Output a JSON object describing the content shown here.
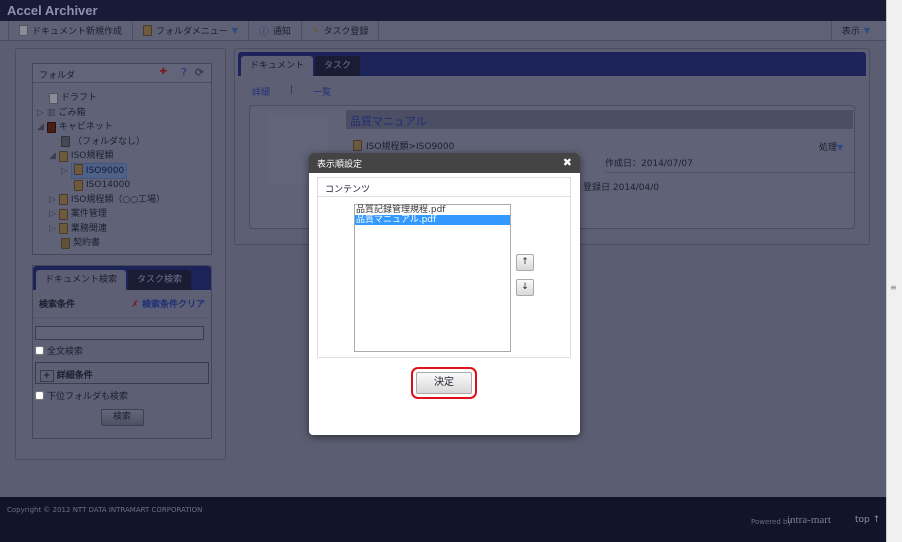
{
  "app": {
    "title": "Accel Archiver"
  },
  "toolbar": {
    "new_doc": "ドキュメント新規作成",
    "folder_menu": "フォルダメニュー",
    "notice": "通知",
    "task_register": "タスク登録",
    "view": "表示"
  },
  "folder_panel": {
    "title": "フォルダ",
    "items": [
      {
        "label": "ドラフト"
      },
      {
        "label": "ごみ箱"
      },
      {
        "label": "キャビネット"
      },
      {
        "label": "（フォルダなし）"
      },
      {
        "label": "ISO規程類"
      },
      {
        "label": "ISO9000"
      },
      {
        "label": "ISO14000"
      },
      {
        "label": "ISO規程類（○○工場）"
      },
      {
        "label": "案件管理"
      },
      {
        "label": "業務関連"
      },
      {
        "label": "契約書"
      }
    ]
  },
  "search_panel": {
    "tabs": [
      "ドキュメント検索",
      "タスク検索"
    ],
    "conditions_label": "検索条件",
    "clear_label": "検索条件クリア",
    "input_value": "",
    "fulltext_label": "全文検索",
    "details_label": "詳細条件",
    "subfolder_label": "下位フォルダも検索",
    "search_button": "検索"
  },
  "main": {
    "tabs": [
      "ドキュメント",
      "タスク"
    ],
    "view_links": [
      "詳細",
      "一覧"
    ],
    "doc_title": "品質マニュアル",
    "doc_path": "ISO規程類>ISO9000",
    "action": "処理",
    "created": "作成日：2014/07/07",
    "registered": "登録日 2014/04/0"
  },
  "modal": {
    "title": "表示順設定",
    "section": "コンテンツ",
    "items": [
      "品質記録管理規程.pdf",
      "品質マニュアル.pdf"
    ],
    "selected_index": 1,
    "up": "↑",
    "down": "↓",
    "ok": "決定"
  },
  "footer": {
    "copyright": "Copyright © 2012 NTT DATA INTRAMART CORPORATION",
    "powered": "Powered by",
    "brand": "intra-mart",
    "top": "top ↑"
  },
  "colors": {
    "highlight": "#3399ff",
    "confirm_ring": "#e0101a"
  }
}
